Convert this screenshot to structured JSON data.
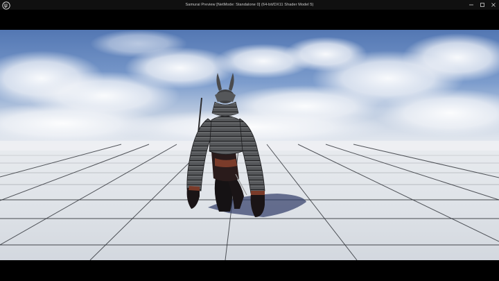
{
  "window": {
    "title": "Samurai Preview [NetMode: Standalone 0]  (64-bit/DX11 Shader Model 5)",
    "logo_icon": "unreal-engine-logo-icon",
    "controls": {
      "minimize_icon": "minimize-icon",
      "maximize_icon": "maximize-icon",
      "close_icon": "close-icon"
    }
  },
  "viewport": {
    "scene": "game-viewport",
    "character": "samurai-armored-character",
    "sky_color": "#5f86bf",
    "floor_color": "#dde1e7",
    "grid_color": "#2a2d33"
  }
}
